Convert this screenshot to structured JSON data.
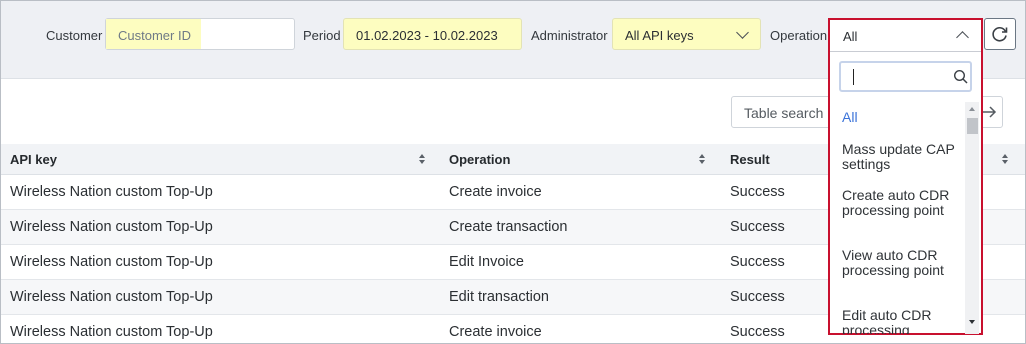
{
  "filters": {
    "customer_label": "Customer",
    "customer_placeholder": "Customer ID",
    "period_label": "Period",
    "period_value": "01.02.2023 - 10.02.2023",
    "administrator_label": "Administrator",
    "administrator_value": "All API keys",
    "operation_label": "Operation",
    "operation_value": "All"
  },
  "table": {
    "search_placeholder": "Table search",
    "columns": [
      "API key",
      "Operation",
      "Result"
    ],
    "rows": [
      {
        "api_key": "Wireless Nation custom Top-Up",
        "operation": "Create invoice",
        "result": "Success"
      },
      {
        "api_key": "Wireless Nation custom Top-Up",
        "operation": "Create transaction",
        "result": "Success"
      },
      {
        "api_key": "Wireless Nation custom Top-Up",
        "operation": "Edit Invoice",
        "result": "Success"
      },
      {
        "api_key": "Wireless Nation custom Top-Up",
        "operation": "Edit transaction",
        "result": "Success"
      },
      {
        "api_key": "Wireless Nation custom Top-Up",
        "operation": "Create invoice",
        "result": "Success"
      }
    ]
  },
  "operation_dropdown": {
    "selected": "All",
    "options": [
      "All",
      "Mass update CAP settings",
      "Create auto CDR processing point",
      "View auto CDR processing point",
      "Edit auto CDR processing"
    ]
  },
  "colors": {
    "highlight": "#fdfdc0",
    "dropdown_border": "#c8102e",
    "active_option": "#3b73d9"
  }
}
